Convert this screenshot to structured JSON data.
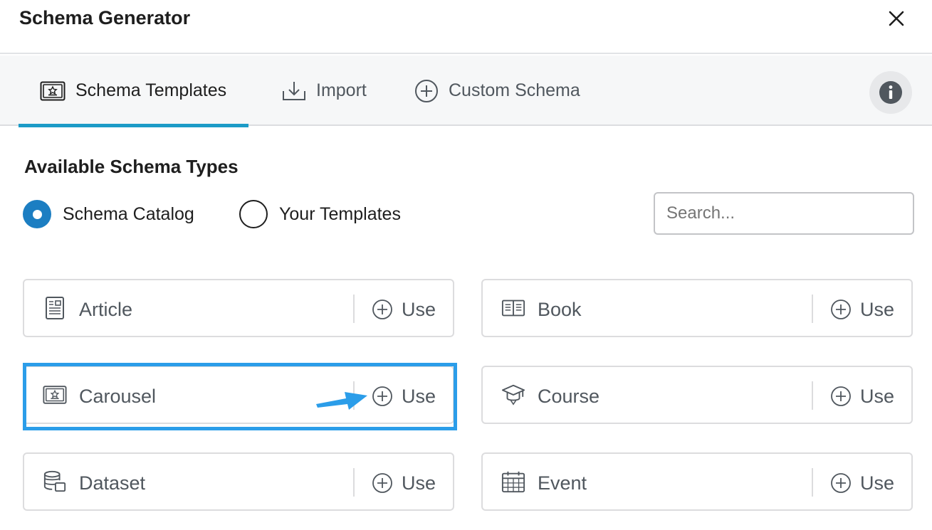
{
  "header": {
    "title": "Schema Generator"
  },
  "tabs": [
    {
      "label": "Schema Templates",
      "icon": "certificate-icon",
      "active": true
    },
    {
      "label": "Import",
      "icon": "download-icon"
    },
    {
      "label": "Custom Schema",
      "icon": "plus-circle-icon"
    }
  ],
  "section": {
    "title": "Available Schema Types",
    "radios": [
      {
        "label": "Schema Catalog",
        "selected": true
      },
      {
        "label": "Your Templates",
        "selected": false
      }
    ],
    "search_placeholder": "Search..."
  },
  "cards": [
    {
      "label": "Article",
      "icon": "article-icon",
      "use": "Use"
    },
    {
      "label": "Book",
      "icon": "book-icon",
      "use": "Use"
    },
    {
      "label": "Carousel",
      "icon": "certificate-icon",
      "use": "Use"
    },
    {
      "label": "Course",
      "icon": "graduation-cap-icon",
      "use": "Use"
    },
    {
      "label": "Dataset",
      "icon": "database-icon",
      "use": "Use"
    },
    {
      "label": "Event",
      "icon": "calendar-icon",
      "use": "Use"
    }
  ],
  "colors": {
    "accent": "#1c9bc7",
    "radio": "#1c7ec2",
    "highlight": "#2b9de9"
  }
}
